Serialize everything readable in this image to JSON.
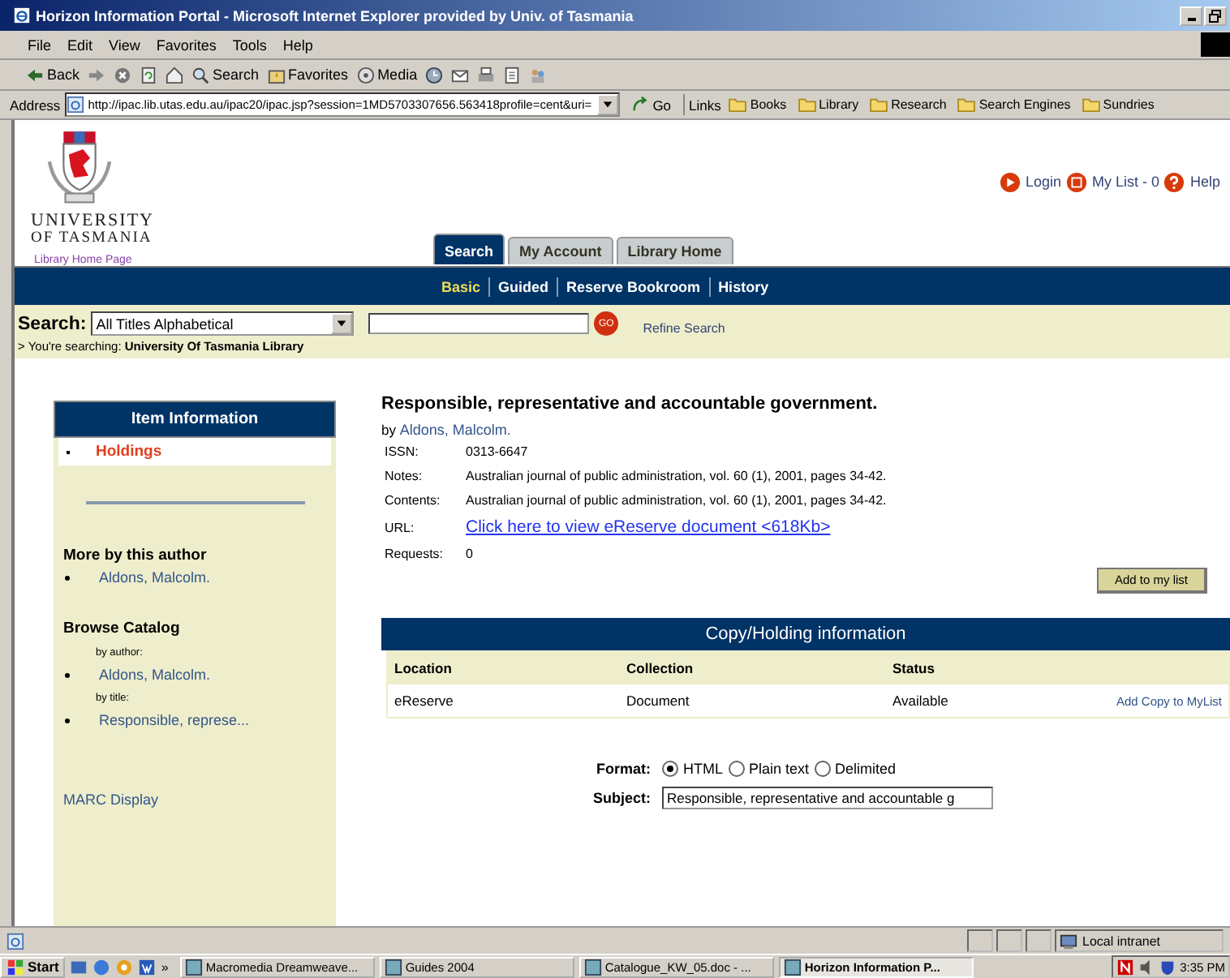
{
  "window": {
    "title": "Horizon Information Portal - Microsoft Internet Explorer provided by Univ. of Tasmania"
  },
  "menu": [
    "File",
    "Edit",
    "View",
    "Favorites",
    "Tools",
    "Help"
  ],
  "toolbar": [
    {
      "kind": "back",
      "label": "Back"
    },
    {
      "kind": "forward"
    },
    {
      "kind": "stop"
    },
    {
      "kind": "refresh"
    },
    {
      "kind": "home"
    },
    {
      "kind": "search",
      "label": "Search"
    },
    {
      "kind": "favorites",
      "label": "Favorites"
    },
    {
      "kind": "media",
      "label": "Media"
    },
    {
      "kind": "history"
    },
    {
      "kind": "mail"
    },
    {
      "kind": "print"
    },
    {
      "kind": "edit"
    },
    {
      "kind": "discuss"
    }
  ],
  "address": {
    "label": "Address",
    "value": "http://ipac.lib.utas.edu.au/ipac20/ipac.jsp?session=1MD5703307656.563418profile=cent&uri=",
    "go": "Go"
  },
  "links": {
    "label": "Links",
    "items": [
      "Books",
      "Library",
      "Research",
      "Search Engines",
      "Sundries"
    ]
  },
  "logo": {
    "line_1": "UNIVERSITY",
    "line_2": "OF TASMANIA",
    "link": "Library Home Page"
  },
  "top_links": [
    {
      "kind": "login",
      "label": "Login"
    },
    {
      "kind": "list",
      "label": "My List - 0"
    },
    {
      "kind": "help",
      "label": "Help"
    }
  ],
  "tabs": [
    {
      "label": "Search",
      "selected": true
    },
    {
      "label": "My Account",
      "selected": false
    },
    {
      "label": "Library Home",
      "selected": false
    }
  ],
  "subnav": [
    {
      "label": "Basic",
      "selected": true
    },
    {
      "label": "Guided",
      "selected": false
    },
    {
      "label": "Reserve Bookroom",
      "selected": false
    },
    {
      "label": "History",
      "selected": false
    }
  ],
  "search": {
    "label": "Search:",
    "index": "All Titles Alphabetical",
    "go": "GO",
    "refine": "Refine Search",
    "scope": "> You're searching: **University Of Tasmania Library**"
  },
  "sidebar": {
    "title": "Item Information",
    "items": [
      {
        "label": "Holdings",
        "selected": true
      }
    ],
    "more_title": "More by this author",
    "more_items": [
      "Aldons, Malcolm."
    ],
    "browse_title": "Browse Catalog",
    "browse": [
      {
        "label": "by author:",
        "item": "Aldons, Malcolm."
      },
      {
        "label": "by title:",
        "item": "Responsible, represe..."
      }
    ],
    "marc": "MARC Display"
  },
  "record": {
    "title": "Responsible, representative and accountable government.",
    "by": "by",
    "author": "Aldons, Malcolm.",
    "fields": [
      {
        "kind": "text",
        "label": "ISSN:",
        "value": "0313-6647"
      },
      {
        "kind": "text",
        "label": "Notes:",
        "value": "Australian journal of public administration, vol. 60 (1), 2001, pages 34-42."
      },
      {
        "kind": "text",
        "label": "Contents:",
        "value": "Australian journal of public administration, vol. 60 (1), 2001, pages 34-42."
      },
      {
        "kind": "link",
        "label": "URL:",
        "value": "Click here to view eReserve document <618Kb>"
      },
      {
        "kind": "text",
        "label": "Requests:",
        "value": "0"
      }
    ],
    "add_button": "Add to my list"
  },
  "holdings": {
    "title": "Copy/Holding information",
    "columns": [
      "Location",
      "Collection",
      "Status"
    ],
    "rows": [
      {
        "cells": [
          "eReserve",
          "Document",
          "Available"
        ],
        "action": "Add Copy to MyList"
      }
    ]
  },
  "export": {
    "format_label": "Format:",
    "formats": [
      {
        "label": "HTML",
        "selected": true
      },
      {
        "label": "Plain text",
        "selected": false
      },
      {
        "label": "Delimited",
        "selected": false
      }
    ],
    "subject_label": "Subject:",
    "subject": "Responsible, representative and accountable g"
  },
  "status_bar": {
    "zone": "Local intranet"
  },
  "taskbar": {
    "start": "Start",
    "more": "»",
    "tasks": [
      {
        "label": "Macromedia Dreamweave...",
        "selected": false
      },
      {
        "label": "Guides 2004",
        "selected": false
      },
      {
        "label": "Catalogue_KW_05.doc - ...",
        "selected": false
      },
      {
        "label": "Horizon Information P...",
        "selected": true
      }
    ],
    "clock": "3:35 PM"
  }
}
